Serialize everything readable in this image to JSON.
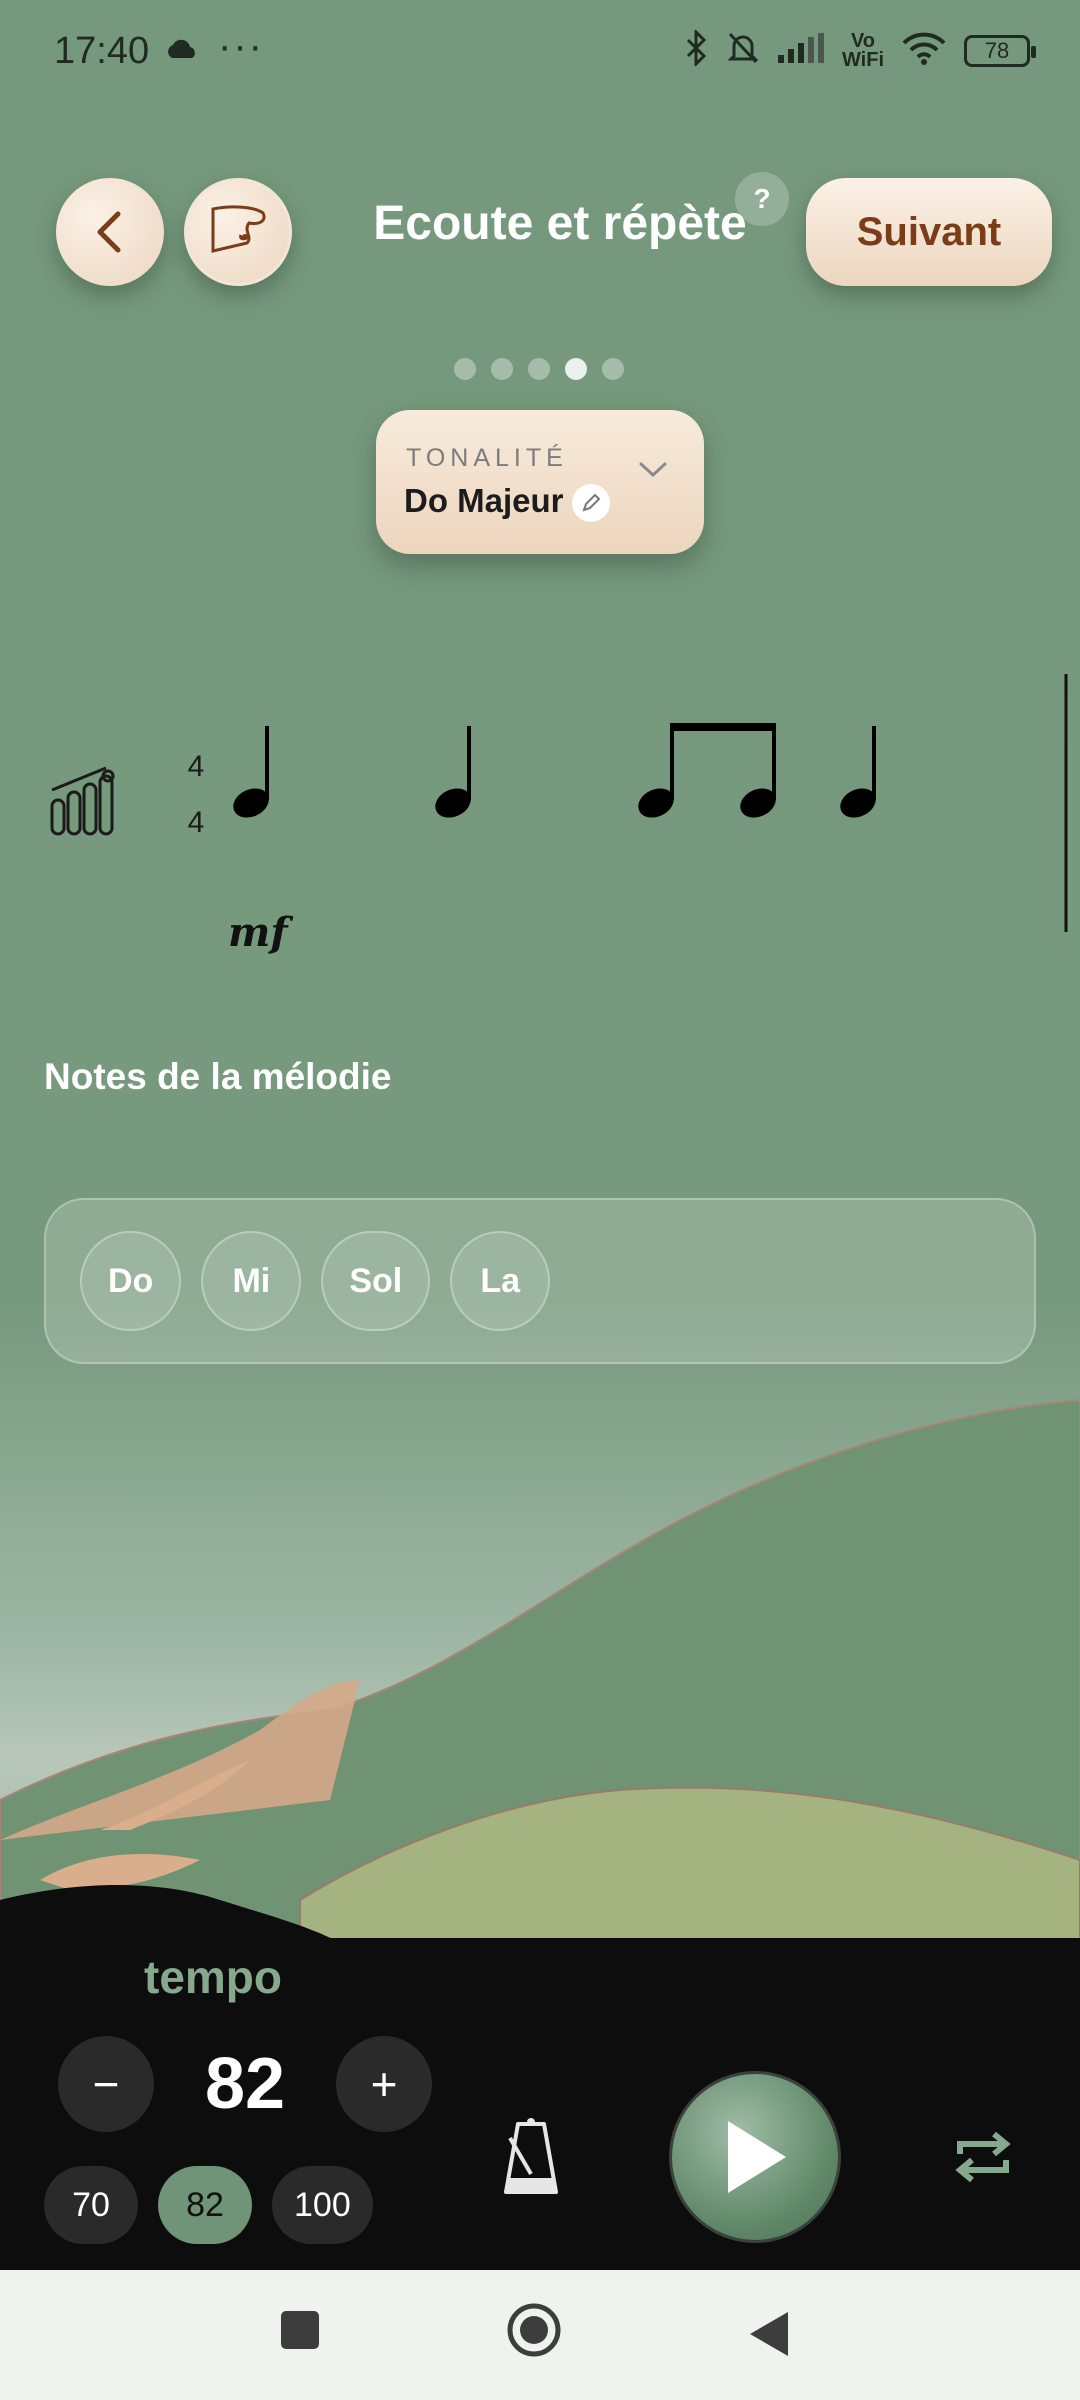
{
  "status_bar": {
    "time": "17:40",
    "more": "···",
    "battery": "78",
    "vowifi_top": "Vo",
    "vowifi_bottom": "WiFi",
    "icons": [
      "cloud-icon",
      "bluetooth-icon",
      "bell-off-icon",
      "signal-icon",
      "wifi-icon",
      "battery-icon"
    ]
  },
  "header": {
    "title": "Ecoute et répète",
    "help": "?",
    "next_label": "Suivant"
  },
  "progress": {
    "total_steps": 5,
    "current_step": 4
  },
  "tonality": {
    "label": "TONALITÉ",
    "value": "Do Majeur"
  },
  "score": {
    "time_signature_top": "4",
    "time_signature_bottom": "4",
    "dynamic": "mf"
  },
  "melody": {
    "title": "Notes de la mélodie",
    "notes": [
      "Do",
      "Mi",
      "Sol",
      "La"
    ]
  },
  "tempo": {
    "label": "tempo",
    "value": "82",
    "minus": "−",
    "plus": "+",
    "presets": [
      "70",
      "82",
      "100"
    ],
    "selected_preset": "82"
  },
  "colors": {
    "background": "#77997d",
    "accent_cream": "#f5e5d3",
    "next_text": "#7a3d18",
    "tempo_label": "#86a98d",
    "panel": "#0d0d0d"
  }
}
